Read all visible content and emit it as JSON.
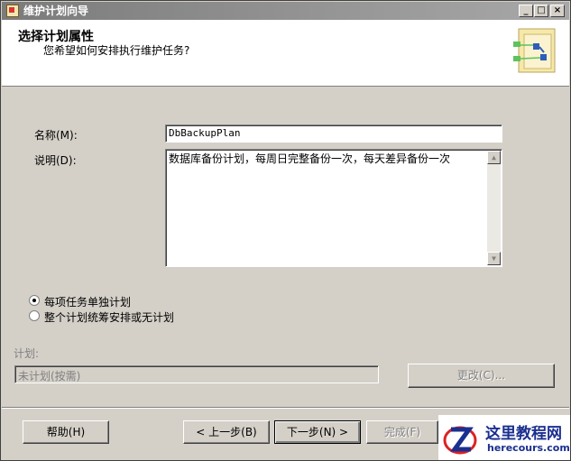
{
  "window": {
    "title": "维护计划向导"
  },
  "header": {
    "title": "选择计划属性",
    "subtitle": "您希望如何安排执行维护任务?"
  },
  "form": {
    "name_label": "名称(M):",
    "name_value": "DbBackupPlan",
    "description_label": "说明(D):",
    "description_value": "数据库备份计划，每周日完整备份一次，每天差异备份一次"
  },
  "schedule_options": {
    "option1": "每项任务单独计划",
    "option2": "整个计划统筹安排或无计划",
    "selected": "option1"
  },
  "schedule": {
    "label": "计划:",
    "value": "未计划(按需)",
    "change_button": "更改(C)..."
  },
  "footer": {
    "help_button": "帮助(H)",
    "back_button": "< 上一步(B)",
    "next_button": "下一步(N) >",
    "finish_button": "完成(F)"
  },
  "watermark": {
    "title": "这里教程网",
    "url": "herecours.com"
  }
}
